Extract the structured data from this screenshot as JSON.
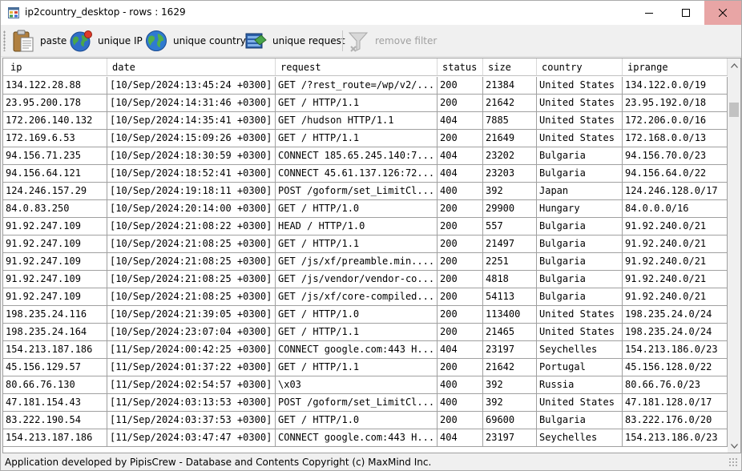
{
  "window": {
    "title": "ip2country_desktop - rows : 1629"
  },
  "toolbar": {
    "paste_label": "paste",
    "unique_ip_label": "unique IP",
    "unique_country_label": "unique country",
    "unique_request_label": "unique request",
    "remove_filter_label": "remove filter"
  },
  "table": {
    "columns": [
      "ip",
      "date",
      "request",
      "status",
      "size",
      "country",
      "iprange"
    ],
    "rows": [
      [
        "134.122.28.88",
        "[10/Sep/2024:13:45:24 +0300]",
        "GET /?rest_route=/wp/v2/...",
        "200",
        "21384",
        "United States",
        "134.122.0.0/19"
      ],
      [
        "23.95.200.178",
        "[10/Sep/2024:14:31:46 +0300]",
        "GET / HTTP/1.1",
        "200",
        "21642",
        "United States",
        "23.95.192.0/18"
      ],
      [
        "172.206.140.132",
        "[10/Sep/2024:14:35:41 +0300]",
        "GET /hudson HTTP/1.1",
        "404",
        "7885",
        "United States",
        "172.206.0.0/16"
      ],
      [
        "172.169.6.53",
        "[10/Sep/2024:15:09:26 +0300]",
        "GET / HTTP/1.1",
        "200",
        "21649",
        "United States",
        "172.168.0.0/13"
      ],
      [
        "94.156.71.235",
        "[10/Sep/2024:18:30:59 +0300]",
        "CONNECT 185.65.245.140:7...",
        "404",
        "23202",
        "Bulgaria",
        "94.156.70.0/23"
      ],
      [
        "94.156.64.121",
        "[10/Sep/2024:18:52:41 +0300]",
        "CONNECT 45.61.137.126:72...",
        "404",
        "23203",
        "Bulgaria",
        "94.156.64.0/22"
      ],
      [
        "124.246.157.29",
        "[10/Sep/2024:19:18:11 +0300]",
        "POST /goform/set_LimitCl...",
        "400",
        "392",
        "Japan",
        "124.246.128.0/17"
      ],
      [
        "84.0.83.250",
        "[10/Sep/2024:20:14:00 +0300]",
        "GET / HTTP/1.0",
        "200",
        "29900",
        "Hungary",
        "84.0.0.0/16"
      ],
      [
        "91.92.247.109",
        "[10/Sep/2024:21:08:22 +0300]",
        "HEAD / HTTP/1.0",
        "200",
        "557",
        "Bulgaria",
        "91.92.240.0/21"
      ],
      [
        "91.92.247.109",
        "[10/Sep/2024:21:08:25 +0300]",
        "GET / HTTP/1.1",
        "200",
        "21497",
        "Bulgaria",
        "91.92.240.0/21"
      ],
      [
        "91.92.247.109",
        "[10/Sep/2024:21:08:25 +0300]",
        "GET /js/xf/preamble.min....",
        "200",
        "2251",
        "Bulgaria",
        "91.92.240.0/21"
      ],
      [
        "91.92.247.109",
        "[10/Sep/2024:21:08:25 +0300]",
        "GET /js/vendor/vendor-co...",
        "200",
        "4818",
        "Bulgaria",
        "91.92.240.0/21"
      ],
      [
        "91.92.247.109",
        "[10/Sep/2024:21:08:25 +0300]",
        "GET /js/xf/core-compiled...",
        "200",
        "54113",
        "Bulgaria",
        "91.92.240.0/21"
      ],
      [
        "198.235.24.116",
        "[10/Sep/2024:21:39:05 +0300]",
        "GET / HTTP/1.0",
        "200",
        "113400",
        "United States",
        "198.235.24.0/24"
      ],
      [
        "198.235.24.164",
        "[10/Sep/2024:23:07:04 +0300]",
        "GET / HTTP/1.1",
        "200",
        "21465",
        "United States",
        "198.235.24.0/24"
      ],
      [
        "154.213.187.186",
        "[11/Sep/2024:00:42:25 +0300]",
        "CONNECT google.com:443 H...",
        "404",
        "23197",
        "Seychelles",
        "154.213.186.0/23"
      ],
      [
        "45.156.129.57",
        "[11/Sep/2024:01:37:22 +0300]",
        "GET / HTTP/1.1",
        "200",
        "21642",
        "Portugal",
        "45.156.128.0/22"
      ],
      [
        "80.66.76.130",
        "[11/Sep/2024:02:54:57 +0300]",
        "\\x03",
        "400",
        "392",
        "Russia",
        "80.66.76.0/23"
      ],
      [
        "47.181.154.43",
        "[11/Sep/2024:03:13:53 +0300]",
        "POST /goform/set_LimitCl...",
        "400",
        "392",
        "United States",
        "47.181.128.0/17"
      ],
      [
        "83.222.190.54",
        "[11/Sep/2024:03:37:53 +0300]",
        "GET / HTTP/1.0",
        "200",
        "69600",
        "Bulgaria",
        "83.222.176.0/20"
      ],
      [
        "154.213.187.186",
        "[11/Sep/2024:03:47:47 +0300]",
        "CONNECT google.com:443 H...",
        "404",
        "23197",
        "Seychelles",
        "154.213.186.0/23"
      ]
    ]
  },
  "statusbar": {
    "text": "Application developed by PipisCrew - Database and Contents Copyright (c) MaxMind Inc."
  },
  "colors": {
    "close_hover": "#e8a5a5",
    "grid_line": "#a0a0a0",
    "chrome": "#f0f0f0"
  },
  "icons": {
    "app": "app-window-icon",
    "paste": "clipboard-icon",
    "unique_ip": "globe-alert-icon",
    "unique_country": "globe-icon",
    "unique_request": "database-icon",
    "remove_filter": "funnel-icon"
  }
}
